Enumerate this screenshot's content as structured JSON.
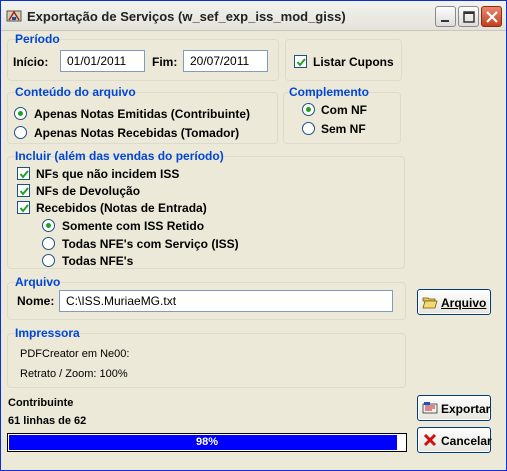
{
  "window": {
    "title": "Exportação de Serviços (w_sef_exp_iss_mod_giss)"
  },
  "periodo": {
    "title": "Período",
    "inicio_label": "Início:",
    "inicio_value": "01/01/2011",
    "fim_label": "Fim:",
    "fim_value": "20/07/2011",
    "listar_cupons_label": "Listar Cupons",
    "listar_cupons_checked": true
  },
  "conteudo": {
    "title": "Conteúdo do arquivo",
    "options": [
      "Apenas Notas Emitidas (Contribuinte)",
      "Apenas Notas Recebidas (Tomador)"
    ],
    "selected": 0
  },
  "complemento": {
    "title": "Complemento",
    "options": [
      "Com NF",
      "Sem NF"
    ],
    "selected": 0
  },
  "incluir": {
    "title": "Incluir (além das vendas do período)",
    "checks": [
      {
        "label": "NFs que não incidem ISS",
        "checked": true
      },
      {
        "label": "NFs de Devolução",
        "checked": true
      },
      {
        "label": "Recebidos (Notas de Entrada)",
        "checked": true
      }
    ],
    "sub_options": [
      "Somente com ISS Retido",
      "Todas NFE's com Serviço (ISS)",
      "Todas NFE's"
    ],
    "sub_selected": 0
  },
  "arquivo": {
    "title": "Arquivo",
    "nome_label": "Nome:",
    "nome_value": "C:\\ISS.MuriaeMG.txt",
    "button_label": "Arquivo"
  },
  "impressora": {
    "title": "Impressora",
    "line1": "PDFCreator em Ne00:",
    "line2": "Retrato / Zoom: 100%"
  },
  "status": {
    "contribuinte": "Contribuinte",
    "linhas": "61 linhas de 62",
    "progress_text": "98%",
    "progress_value": 0.98
  },
  "buttons": {
    "exportar": "Exportar",
    "cancelar": "Cancelar"
  },
  "colors": {
    "group_title": "#0046d5",
    "progress_fill": "#0000ff",
    "radio_dot": "#21a121"
  }
}
